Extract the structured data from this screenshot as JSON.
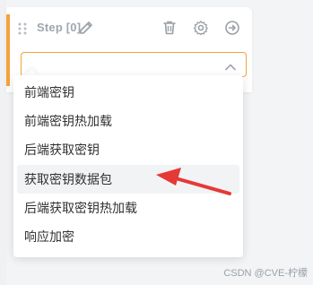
{
  "step": {
    "title": "Step [0]"
  },
  "select": {
    "value": "",
    "placeholder": ""
  },
  "dropdown": {
    "options": [
      {
        "label": "前端密钥"
      },
      {
        "label": "前端密钥热加载"
      },
      {
        "label": "后端获取密钥"
      },
      {
        "label": "获取密钥数据包"
      },
      {
        "label": "后端获取密钥热加载"
      },
      {
        "label": "响应加密"
      }
    ],
    "hovered_index": 3
  },
  "icons": {
    "drag": "drag-handle-icon",
    "edit": "edit-icon",
    "delete": "trash-icon",
    "settings": "gear-icon",
    "next": "arrow-right-circle-icon"
  },
  "colors": {
    "accent": "#f5a13b",
    "annotation_arrow": "#e53935"
  },
  "watermark": "CSDN @CVE-柠檬"
}
